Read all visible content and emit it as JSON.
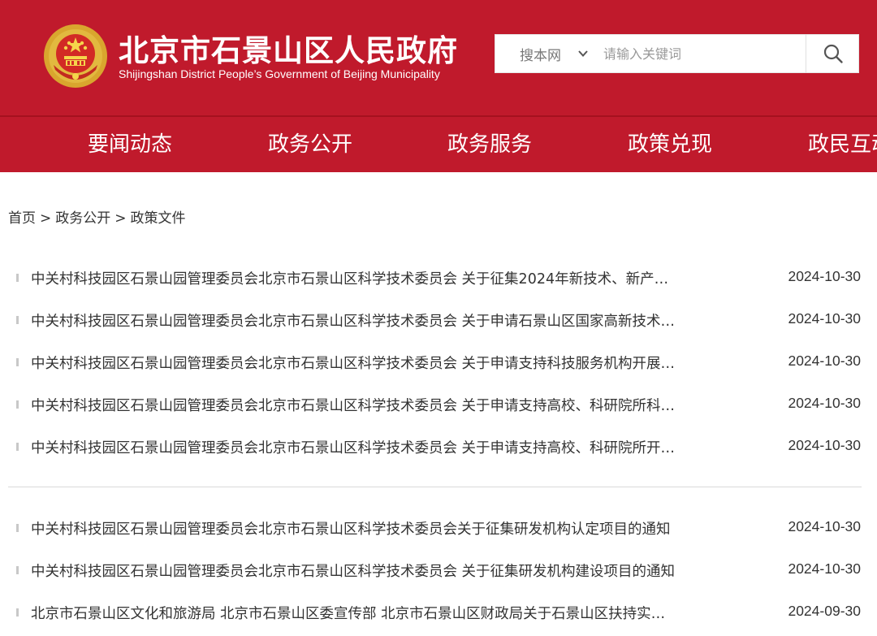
{
  "header": {
    "title": "北京市石景山区人民政府",
    "subtitle": "Shijingshan District People’s Government of Beijing Municipality",
    "brand_color": "#c01a2c"
  },
  "search": {
    "scope_label": "搜本网",
    "placeholder": "请输入关键词",
    "icon": "search-icon"
  },
  "nav": {
    "items": [
      {
        "label": "要闻动态"
      },
      {
        "label": "政务公开"
      },
      {
        "label": "政务服务"
      },
      {
        "label": "政策兑现"
      },
      {
        "label": "政民互动"
      }
    ]
  },
  "breadcrumb": {
    "items": [
      "首页",
      "政务公开",
      "政策文件"
    ],
    "separator": ">"
  },
  "list_group_1": [
    {
      "title": "中关村科技园区石景山园管理委员会北京市石景山区科学技术委员会 关于征集2024年新技术、新产…",
      "date": "2024-10-30"
    },
    {
      "title": "中关村科技园区石景山园管理委员会北京市石景山区科学技术委员会 关于申请石景山区国家高新技术…",
      "date": "2024-10-30"
    },
    {
      "title": "中关村科技园区石景山园管理委员会北京市石景山区科学技术委员会 关于申请支持科技服务机构开展…",
      "date": "2024-10-30"
    },
    {
      "title": "中关村科技园区石景山园管理委员会北京市石景山区科学技术委员会 关于申请支持高校、科研院所科…",
      "date": "2024-10-30"
    },
    {
      "title": "中关村科技园区石景山园管理委员会北京市石景山区科学技术委员会 关于申请支持高校、科研院所开…",
      "date": "2024-10-30"
    }
  ],
  "list_group_2": [
    {
      "title": "中关村科技园区石景山园管理委员会北京市石景山区科学技术委员会关于征集研发机构认定项目的通知",
      "date": "2024-10-30"
    },
    {
      "title": "中关村科技园区石景山园管理委员会北京市石景山区科学技术委员会 关于征集研发机构建设项目的通知",
      "date": "2024-10-30"
    },
    {
      "title": "北京市石景山区文化和旅游局 北京市石景山区委宣传部 北京市石景山区财政局关于石景山区扶持实…",
      "date": "2024-09-30"
    }
  ]
}
